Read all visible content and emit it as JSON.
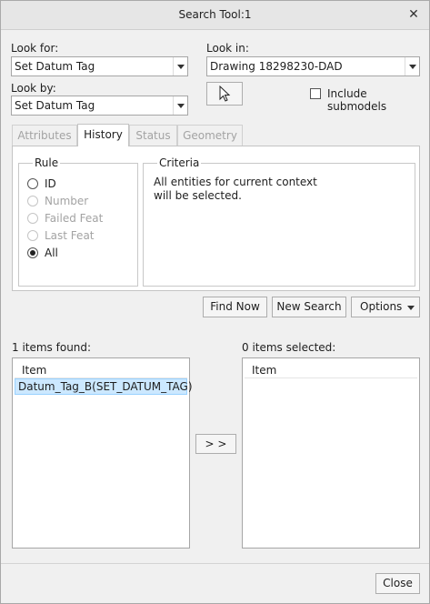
{
  "window": {
    "title": "Search Tool:1",
    "close_glyph": "✕"
  },
  "look_for": {
    "label": "Look for:",
    "value": "Set Datum Tag"
  },
  "look_by": {
    "label": "Look by:",
    "value": "Set Datum Tag"
  },
  "look_in": {
    "label": "Look in:",
    "value": "Drawing 18298230-DAD"
  },
  "include_submodels": {
    "label": "Include submodels",
    "checked": false
  },
  "tabs": [
    {
      "label": "Attributes",
      "active": false
    },
    {
      "label": "History",
      "active": true
    },
    {
      "label": "Status",
      "active": false
    },
    {
      "label": "Geometry",
      "active": false
    }
  ],
  "rule": {
    "title": "Rule",
    "options": [
      {
        "label": "ID",
        "enabled": true,
        "selected": false
      },
      {
        "label": "Number",
        "enabled": false,
        "selected": false
      },
      {
        "label": "Failed Feat",
        "enabled": false,
        "selected": false
      },
      {
        "label": "Last Feat",
        "enabled": false,
        "selected": false
      },
      {
        "label": "All",
        "enabled": true,
        "selected": true
      }
    ]
  },
  "criteria": {
    "title": "Criteria",
    "line1": "All entities for current context",
    "line2": "will be selected."
  },
  "buttons": {
    "find_now": "Find Now",
    "new_search": "New Search",
    "options": "Options",
    "add": "> >",
    "close": "Close"
  },
  "found": {
    "label": "1 items found:",
    "header": "Item",
    "items": [
      "Datum_Tag_B(SET_DATUM_TAG)"
    ]
  },
  "selected": {
    "label": "0 items selected:",
    "header": "Item"
  },
  "icons": {
    "pointer": "arrow-pointer-icon",
    "close": "close-icon",
    "dropdown": "chevron-down-icon"
  }
}
